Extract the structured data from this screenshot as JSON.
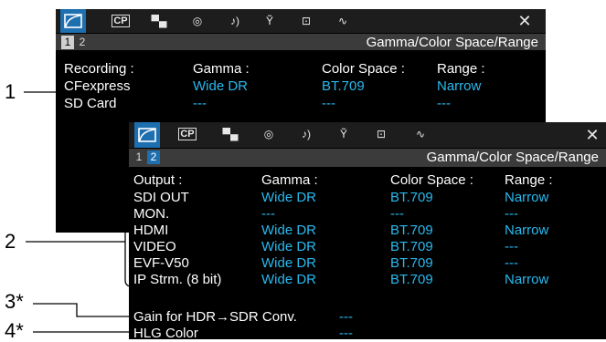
{
  "callouts": [
    "1",
    "2",
    "3*",
    "4*"
  ],
  "tabs": [
    {
      "icon": "gamma-curve-icon"
    },
    {
      "icon": "custom-picture-icon",
      "label": "CP"
    },
    {
      "icon": "camera-record-icon"
    },
    {
      "icon": "settings-dial-icon"
    },
    {
      "icon": "audio-icon",
      "label": "♪)"
    },
    {
      "icon": "wrench-icon"
    },
    {
      "icon": "assign-button-icon"
    },
    {
      "icon": "waveform-icon"
    }
  ],
  "close_label": "✕",
  "screen1": {
    "pages": [
      "1",
      "2"
    ],
    "active_page": 1,
    "title": "Gamma/Color Space/Range",
    "headers": [
      "Recording :",
      "Gamma :",
      "Color Space :",
      "Range :"
    ],
    "rows": [
      {
        "label": "CFexpress",
        "gamma": "Wide DR",
        "color_space": "BT.709",
        "range": "Narrow"
      },
      {
        "label": "SD Card",
        "gamma": "---",
        "color_space": "---",
        "range": "---"
      }
    ]
  },
  "screen2": {
    "pages": [
      "1",
      "2"
    ],
    "active_page": 2,
    "title": "Gamma/Color Space/Range",
    "headers": [
      "Output :",
      "Gamma :",
      "Color Space :",
      "Range :"
    ],
    "rows": [
      {
        "label": "SDI OUT",
        "gamma": "Wide DR",
        "color_space": "BT.709",
        "range": "Narrow"
      },
      {
        "label": "MON.",
        "gamma": "---",
        "color_space": "---",
        "range": "---"
      },
      {
        "label": "HDMI",
        "gamma": "Wide DR",
        "color_space": "BT.709",
        "range": "Narrow"
      },
      {
        "label": "VIDEO",
        "gamma": "Wide DR",
        "color_space": "BT.709",
        "range": "---"
      },
      {
        "label": "EVF-V50",
        "gamma": "Wide DR",
        "color_space": "BT.709",
        "range": "---"
      },
      {
        "label": "IP Strm. (8 bit)",
        "gamma": "Wide DR",
        "color_space": "BT.709",
        "range": "Narrow"
      }
    ],
    "extra": [
      {
        "label": "Gain for HDR→SDR Conv.",
        "value": "---"
      },
      {
        "label": "HLG Color",
        "value": "---"
      }
    ]
  },
  "colors": {
    "accent": "#1e6fb0",
    "value_text": "#28b9ee",
    "tabbar": "#1d1d1d",
    "titlebar": "#3b3b3b"
  }
}
